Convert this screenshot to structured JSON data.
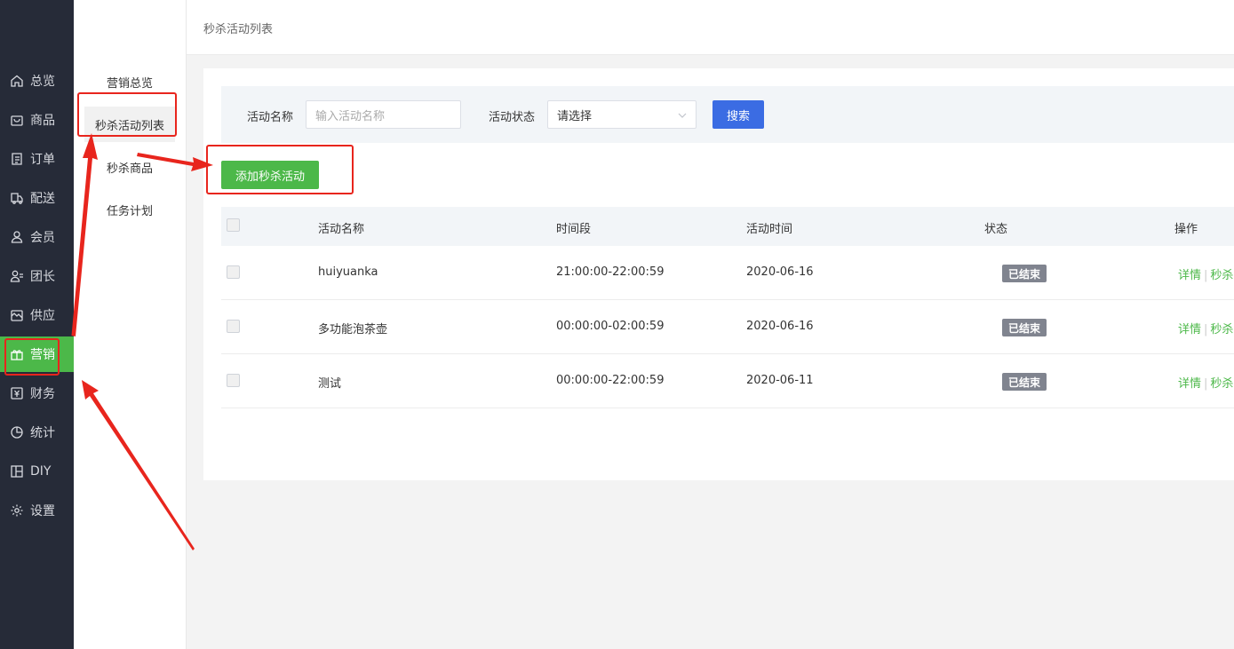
{
  "nav": {
    "items": [
      {
        "label": "总览",
        "icon": "home-icon"
      },
      {
        "label": "商品",
        "icon": "bag-icon"
      },
      {
        "label": "订单",
        "icon": "order-icon"
      },
      {
        "label": "配送",
        "icon": "delivery-icon"
      },
      {
        "label": "会员",
        "icon": "user-icon"
      },
      {
        "label": "团长",
        "icon": "leader-icon"
      },
      {
        "label": "供应",
        "icon": "supply-icon"
      },
      {
        "label": "营销",
        "icon": "gift-icon"
      },
      {
        "label": "财务",
        "icon": "finance-icon"
      },
      {
        "label": "统计",
        "icon": "pie-icon"
      },
      {
        "label": "DIY",
        "icon": "layout-icon"
      },
      {
        "label": "设置",
        "icon": "gear-icon"
      }
    ],
    "active": "营销"
  },
  "submenu": {
    "items": [
      "营销总览",
      "秒杀活动列表",
      "秒杀商品",
      "任务计划"
    ],
    "active": "秒杀活动列表"
  },
  "header": {
    "breadcrumb": "秒杀活动列表"
  },
  "search": {
    "name_label": "活动名称",
    "name_placeholder": "输入活动名称",
    "status_label": "活动状态",
    "status_value": "请选择",
    "search_button": "搜索"
  },
  "toolbar": {
    "add_button": "添加秒杀活动"
  },
  "table": {
    "columns": [
      "活动名称",
      "时间段",
      "活动时间",
      "状态",
      "操作"
    ],
    "rows": [
      {
        "name": "huiyuanka",
        "period": "21:00:00-22:00:59",
        "date": "2020-06-16",
        "status": "已结束",
        "op1": "详情",
        "op2": "秒杀"
      },
      {
        "name": "多功能泡茶壶",
        "period": "00:00:00-02:00:59",
        "date": "2020-06-16",
        "status": "已结束",
        "op1": "详情",
        "op2": "秒杀"
      },
      {
        "name": "测试",
        "period": "00:00:00-22:00:59",
        "date": "2020-06-11",
        "status": "已结束",
        "op1": "详情",
        "op2": "秒杀"
      }
    ]
  },
  "colors": {
    "nav_bg": "#262b38",
    "accent_green": "#4cb849",
    "primary_blue": "#3b6ce3",
    "annotation_red": "#e8251d",
    "badge_gray": "#80848f"
  }
}
